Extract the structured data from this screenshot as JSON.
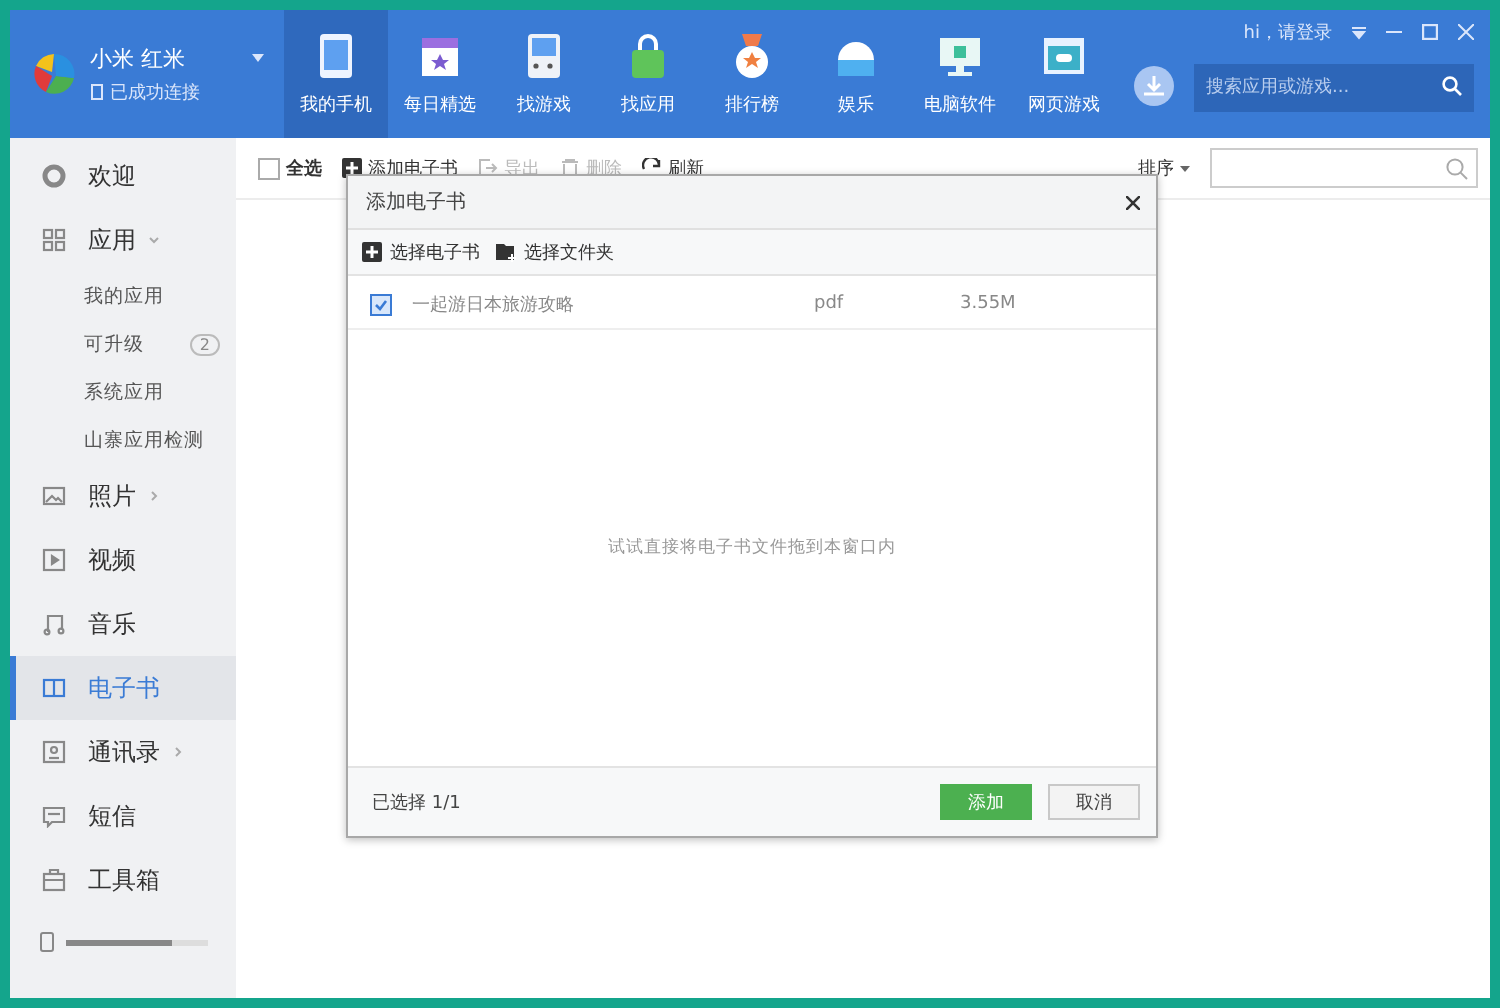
{
  "device": {
    "name": "小米 红米",
    "status": "已成功连接"
  },
  "nav_tabs": [
    {
      "label": "我的手机",
      "selected": true
    },
    {
      "label": "每日精选",
      "selected": false
    },
    {
      "label": "找游戏",
      "selected": false
    },
    {
      "label": "找应用",
      "selected": false
    },
    {
      "label": "排行榜",
      "selected": false
    },
    {
      "label": "娱乐",
      "selected": false
    },
    {
      "label": "电脑软件",
      "selected": false
    },
    {
      "label": "网页游戏",
      "selected": false
    }
  ],
  "login": "hi，请登录",
  "top_search": {
    "placeholder": "搜索应用或游戏..."
  },
  "sidebar": {
    "items": [
      {
        "label": "欢迎",
        "selected": false
      },
      {
        "label": "应用",
        "selected": false,
        "expanded": true,
        "children": [
          {
            "label": "我的应用"
          },
          {
            "label": "可升级",
            "count": "2"
          },
          {
            "label": "系统应用"
          },
          {
            "label": "山寨应用检测"
          }
        ]
      },
      {
        "label": "照片",
        "selected": false,
        "expanded": false
      },
      {
        "label": "视频",
        "selected": false
      },
      {
        "label": "音乐",
        "selected": false
      },
      {
        "label": "电子书",
        "selected": true
      },
      {
        "label": "通讯录",
        "selected": false,
        "expanded": false
      },
      {
        "label": "短信",
        "selected": false
      },
      {
        "label": "工具箱",
        "selected": false
      }
    ],
    "storage": {
      "level": 0.75
    }
  },
  "toolbar": {
    "select_all": {
      "label": "全选",
      "checked": false
    },
    "actions": [
      {
        "label": "添加电子书",
        "disabled": false
      },
      {
        "label": "导出",
        "disabled": true
      },
      {
        "label": "删除",
        "disabled": true
      },
      {
        "label": "刷新",
        "disabled": false
      }
    ],
    "sort": "排序"
  },
  "dialog": {
    "title": "添加电子书",
    "tools": [
      {
        "label": "选择电子书"
      },
      {
        "label": "选择文件夹"
      }
    ],
    "files": [
      {
        "name": "一起游日本旅游攻略",
        "type": "pdf",
        "size": "3.55M",
        "checked": true
      }
    ],
    "hint": "试试直接将电子书文件拖到本窗口内",
    "status": "已选择 1/1",
    "buttons": [
      {
        "label": "添加",
        "kind": "primary"
      },
      {
        "label": "取消",
        "kind": "secondary"
      }
    ]
  }
}
